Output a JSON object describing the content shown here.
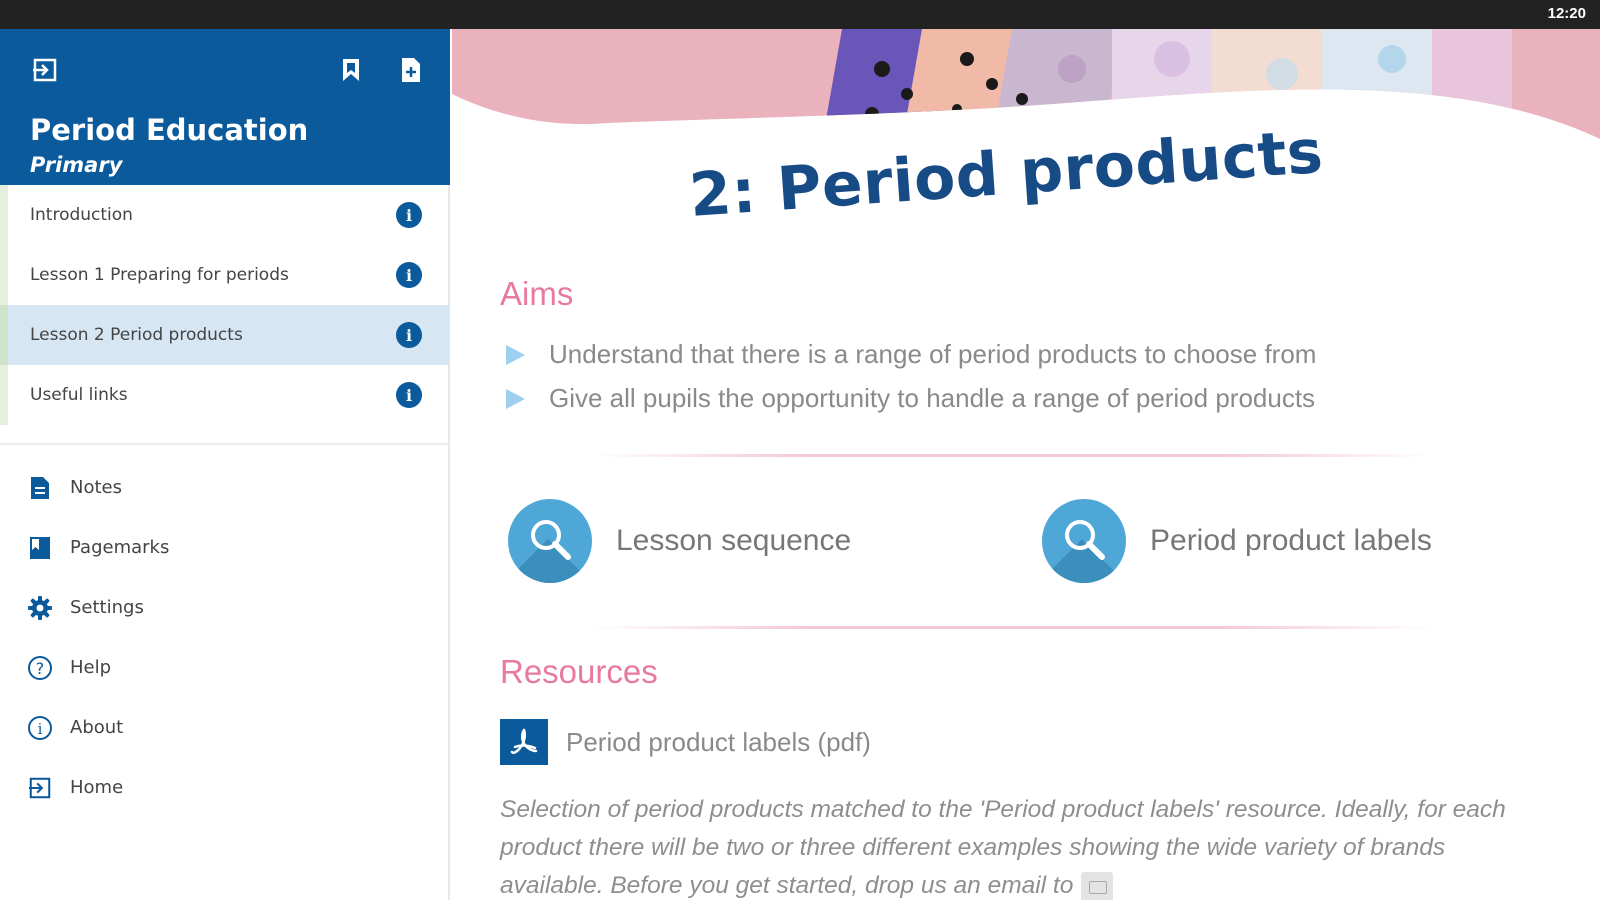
{
  "status_bar": {
    "time": "12:20"
  },
  "sidebar": {
    "title": "Period Education",
    "subtitle": "Primary",
    "header_icons": [
      "exit-icon",
      "bookmark-icon",
      "add-note-icon"
    ],
    "lessons": [
      {
        "label": "Introduction",
        "active": false
      },
      {
        "label": "Lesson 1 Preparing for periods",
        "active": false
      },
      {
        "label": "Lesson 2 Period products",
        "active": true
      },
      {
        "label": "Useful links",
        "active": false
      }
    ],
    "menu": [
      {
        "label": "Notes",
        "icon": "notes-icon"
      },
      {
        "label": "Pagemarks",
        "icon": "pagemarks-icon"
      },
      {
        "label": "Settings",
        "icon": "gear-icon"
      },
      {
        "label": "Help",
        "icon": "help-icon"
      },
      {
        "label": "About",
        "icon": "about-icon"
      },
      {
        "label": "Home",
        "icon": "home-icon"
      }
    ]
  },
  "main": {
    "title": "2: Period products",
    "aims_heading": "Aims",
    "aims": [
      "Understand that there is a range of period products to choose from",
      "Give all pupils the opportunity to handle a range of period products"
    ],
    "cards": [
      {
        "label": "Lesson sequence",
        "icon": "magnifier-icon"
      },
      {
        "label": "Period product labels",
        "icon": "magnifier-icon"
      }
    ],
    "resources_heading": "Resources",
    "resource_link": "Period product labels (pdf)",
    "resource_description": "Selection of period products matched to the 'Period product labels' resource. Ideally, for each product there will be two or three different examples showing the wide variety of brands available. Before you get started, drop us an email to"
  },
  "colors": {
    "primary_blue": "#0a5a9c",
    "title_blue": "#174b86",
    "heading_pink": "#e87aa0",
    "banner_pink": "#eab2bd",
    "active_row": "#d6e6f2",
    "accent_light_blue": "#4ea7d6"
  }
}
